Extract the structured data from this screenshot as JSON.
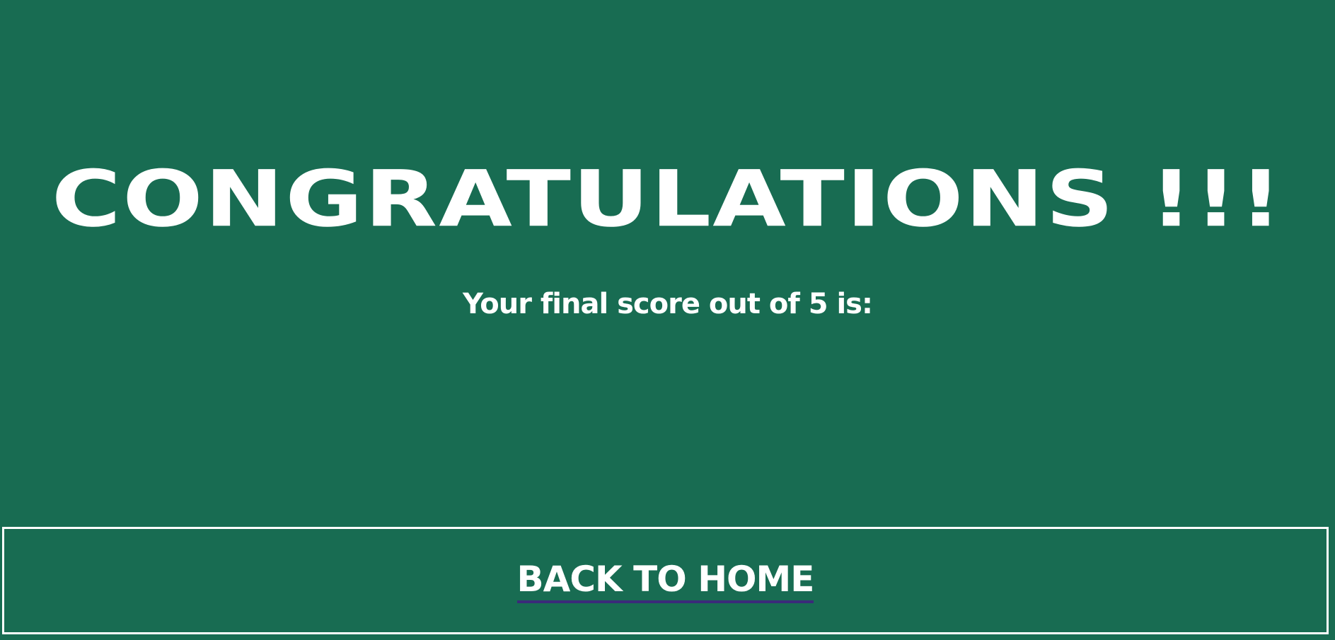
{
  "heading": {
    "title": "CONGRATULATIONS !!!"
  },
  "score": {
    "label": "Your final score out of 5 is:",
    "value": ""
  },
  "navigation": {
    "back_home_label": "BACK TO HOME"
  },
  "colors": {
    "background": "#186c52",
    "text": "#ffffff",
    "link_underline": "#3a2a7a"
  }
}
